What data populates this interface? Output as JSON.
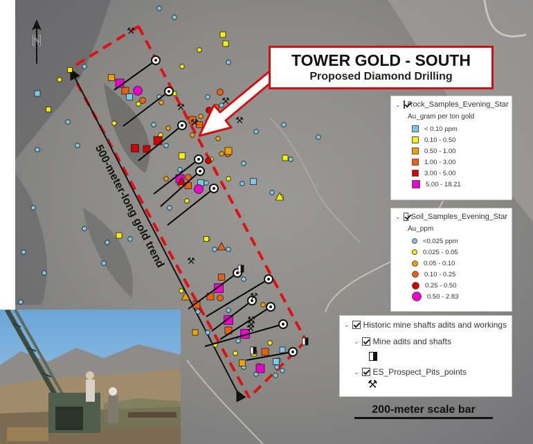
{
  "title": {
    "main": "TOWER GOLD - SOUTH",
    "sub": "Proposed Diamond Drilling"
  },
  "trend_label": "500-meter-long gold trend",
  "north_label": "N",
  "scale_label": "200-meter scale bar",
  "rock_legend": {
    "layer": "Rock_Samples_Evening_Star",
    "field": "Au_gram per ton gold",
    "classes": [
      {
        "label": "< 0.10 ppm",
        "color": "#7ec8e3"
      },
      {
        "label": "0.10 - 0.50",
        "color": "#f5f000"
      },
      {
        "label": "0.50 - 1.00",
        "color": "#f0a000"
      },
      {
        "label": "1.00 - 3.00",
        "color": "#e86010"
      },
      {
        "label": "3.00 - 5.00",
        "color": "#d00000"
      },
      {
        "label": "5.00 - 18.21",
        "color": "#ee00cc"
      }
    ]
  },
  "soil_legend": {
    "layer": "Soil_Samples_Evening_Star",
    "field": "Au_ppm",
    "classes": [
      {
        "label": "<0.025 ppm",
        "color": "#7ec8e3"
      },
      {
        "label": "0.025 - 0.05",
        "color": "#f5f000"
      },
      {
        "label": "0.05 - 0.10",
        "color": "#f0a000"
      },
      {
        "label": "0.10 - 0.25",
        "color": "#e86010"
      },
      {
        "label": "0.25 - 0.50",
        "color": "#d00000"
      },
      {
        "label": "0.50 - 2.83",
        "color": "#ee00cc"
      }
    ]
  },
  "workings_legend": {
    "group": "Historic mine shafts adits and workings",
    "layer1": "Mine adits and shafts",
    "layer2": "ES_Prospect_Pits_points"
  },
  "colors": {
    "trend_box": "#e01010",
    "drill_line": "#000000",
    "terrain": "#8a8a86"
  }
}
